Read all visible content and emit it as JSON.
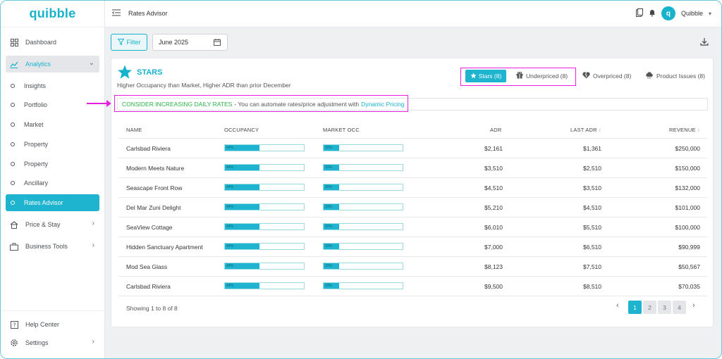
{
  "brand": {
    "logo": "quibble"
  },
  "topbar": {
    "page_title": "Rates Advisor",
    "user_name": "Quibble",
    "avatar_letter": "q"
  },
  "sidebar": {
    "items": [
      {
        "label": "Dashboard",
        "icon": "grid-icon"
      },
      {
        "label": "Analytics",
        "icon": "chart-icon"
      }
    ],
    "sub_items": [
      "Insights",
      "Portfolio",
      "Market",
      "Property",
      "Property",
      "Ancillary",
      "Rates Advisor"
    ],
    "more": [
      {
        "label": "Price & Stay",
        "icon": "house-icon"
      },
      {
        "label": "Business Tools",
        "icon": "briefcase-icon"
      }
    ],
    "bottom": [
      {
        "label": "Help Center",
        "icon": "help-icon"
      },
      {
        "label": "Settings",
        "icon": "gear-icon"
      }
    ]
  },
  "filters": {
    "filter_label": "Filter",
    "date_value": "June 2025"
  },
  "card": {
    "title": "STARS",
    "subtitle": "Higher Occupancy than Market, Higher ADR than prior December",
    "tabs": [
      {
        "label": "Stars (8)",
        "icon": "star-icon"
      },
      {
        "label": "Underpriced (8)",
        "icon": "gift-icon"
      },
      {
        "label": "Overpriced (8)",
        "icon": "broken-heart-icon"
      },
      {
        "label": "Product Issues (8)",
        "icon": "cloud-icon"
      }
    ],
    "advice": {
      "headline": "CONSIDER INCREASING DAILY RATES",
      "text": "- You can automate rates/price adjustment with",
      "link": "Dynamic Pricing"
    }
  },
  "table": {
    "columns": [
      "NAME",
      "OCCUPANCY",
      "MARKET OCC",
      "ADR",
      "LAST ADR",
      "REVENUE"
    ],
    "rows": [
      {
        "name": "Carlsbad Riviera",
        "occ": 44,
        "occ_label": "44%",
        "mkt": 20,
        "mkt_label": "20%",
        "adr": "$2,161",
        "last_adr": "$1,361",
        "revenue": "$250,000"
      },
      {
        "name": "Modern Meets Nature",
        "occ": 44,
        "occ_label": "44%",
        "mkt": 20,
        "mkt_label": "20%",
        "adr": "$3,510",
        "last_adr": "$2,510",
        "revenue": "$150,000"
      },
      {
        "name": "Seascape Front Row",
        "occ": 44,
        "occ_label": "44%",
        "mkt": 20,
        "mkt_label": "20%",
        "adr": "$4,510",
        "last_adr": "$3,510",
        "revenue": "$132,000"
      },
      {
        "name": "Del Mar  Zuni Delight",
        "occ": 44,
        "occ_label": "44%",
        "mkt": 20,
        "mkt_label": "20%",
        "adr": "$5,210",
        "last_adr": "$4,510",
        "revenue": "$101,000"
      },
      {
        "name": "SeaView Cottage",
        "occ": 44,
        "occ_label": "44%",
        "mkt": 20,
        "mkt_label": "20%",
        "adr": "$6,010",
        "last_adr": "$5,510",
        "revenue": "$100,000"
      },
      {
        "name": "Hidden Sanctuary Apartment",
        "occ": 44,
        "occ_label": "44%",
        "mkt": 20,
        "mkt_label": "20%",
        "adr": "$7,000",
        "last_adr": "$6,510",
        "revenue": "$90,999"
      },
      {
        "name": "Mod Sea Glass",
        "occ": 44,
        "occ_label": "44%",
        "mkt": 20,
        "mkt_label": "20%",
        "adr": "$8,123",
        "last_adr": "$7,510",
        "revenue": "$50,567"
      },
      {
        "name": "Carlsbad Riviera",
        "occ": 44,
        "occ_label": "44%",
        "mkt": 20,
        "mkt_label": "20%",
        "adr": "$9,500",
        "last_adr": "$8,510",
        "revenue": "$70,035"
      }
    ]
  },
  "pagination": {
    "info": "Showing 1 to 8 of 8",
    "pages": [
      "1",
      "2",
      "3",
      "4"
    ],
    "current": "1"
  },
  "colors": {
    "accent": "#1eb3cf",
    "highlight": "#e71ee0",
    "green": "#2cb34a"
  }
}
